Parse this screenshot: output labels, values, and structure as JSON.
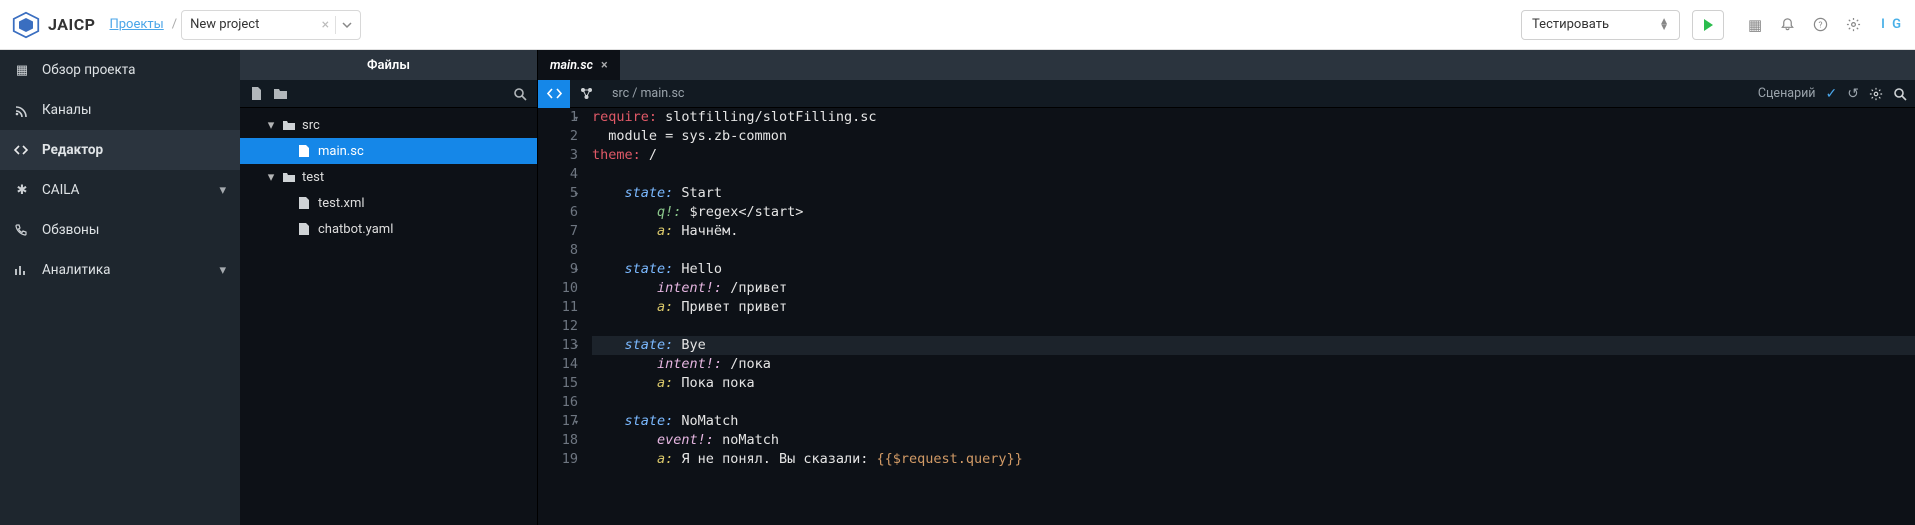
{
  "header": {
    "brand": "JAICP",
    "projects_link": "Проекты",
    "project_name": "New project",
    "test_label": "Тестировать",
    "user_initials": "I G"
  },
  "sidebar": {
    "items": [
      {
        "icon": "grid-icon",
        "label": "Обзор проекта",
        "expandable": false
      },
      {
        "icon": "rss-icon",
        "label": "Каналы",
        "expandable": false
      },
      {
        "icon": "code-icon",
        "label": "Редактор",
        "active": true
      },
      {
        "icon": "atom-icon",
        "label": "CAILA",
        "expandable": true
      },
      {
        "icon": "phone-icon",
        "label": "Обзвоны",
        "expandable": false
      },
      {
        "icon": "chart-icon",
        "label": "Аналитика",
        "expandable": true
      }
    ]
  },
  "filepanel": {
    "title": "Файлы",
    "tree": {
      "src_label": "src",
      "main_file": "main.sc",
      "test_label": "test",
      "test_file": "test.xml",
      "chatbot_file": "chatbot.yaml"
    }
  },
  "editor": {
    "tab_name": "main.sc",
    "breadcrumb": "src / main.sc",
    "scenario_label": "Сценарий",
    "lines": [
      {
        "num": 1,
        "fold": true,
        "tokens": [
          {
            "c": "tok-r",
            "t": "require:"
          },
          {
            "c": "tok-w",
            "t": " slotfilling/slotFilling.sc"
          }
        ]
      },
      {
        "num": 2,
        "tokens": [
          {
            "c": "tok-w",
            "t": "  module = sys.zb-common"
          }
        ]
      },
      {
        "num": 3,
        "tokens": [
          {
            "c": "tok-r",
            "t": "theme:"
          },
          {
            "c": "tok-w",
            "t": " /"
          }
        ]
      },
      {
        "num": 4,
        "tokens": []
      },
      {
        "num": 5,
        "fold": true,
        "tokens": [
          {
            "c": "tok-w",
            "t": "    "
          },
          {
            "c": "tok-b",
            "t": "state:"
          },
          {
            "c": "tok-w",
            "t": " Start"
          }
        ]
      },
      {
        "num": 6,
        "tokens": [
          {
            "c": "tok-w",
            "t": "        "
          },
          {
            "c": "tok-g",
            "t": "q!:"
          },
          {
            "c": "tok-w",
            "t": " $regex</start>"
          }
        ]
      },
      {
        "num": 7,
        "tokens": [
          {
            "c": "tok-w",
            "t": "        "
          },
          {
            "c": "tok-y",
            "t": "a:"
          },
          {
            "c": "tok-w",
            "t": " Начнём."
          }
        ]
      },
      {
        "num": 8,
        "tokens": []
      },
      {
        "num": 9,
        "fold": true,
        "tokens": [
          {
            "c": "tok-w",
            "t": "    "
          },
          {
            "c": "tok-b",
            "t": "state:"
          },
          {
            "c": "tok-w",
            "t": " Hello"
          }
        ]
      },
      {
        "num": 10,
        "tokens": [
          {
            "c": "tok-w",
            "t": "        "
          },
          {
            "c": "tok-m",
            "t": "intent!:"
          },
          {
            "c": "tok-w",
            "t": " /привет"
          }
        ]
      },
      {
        "num": 11,
        "tokens": [
          {
            "c": "tok-w",
            "t": "        "
          },
          {
            "c": "tok-y",
            "t": "a:"
          },
          {
            "c": "tok-w",
            "t": " Привет привет"
          }
        ]
      },
      {
        "num": 12,
        "tokens": []
      },
      {
        "num": 13,
        "fold": true,
        "hilite": true,
        "tokens": [
          {
            "c": "tok-w",
            "t": "    "
          },
          {
            "c": "tok-b",
            "t": "state:"
          },
          {
            "c": "tok-w",
            "t": " Bye"
          }
        ]
      },
      {
        "num": 14,
        "tokens": [
          {
            "c": "tok-w",
            "t": "        "
          },
          {
            "c": "tok-m",
            "t": "intent!:"
          },
          {
            "c": "tok-w",
            "t": " /пока"
          }
        ]
      },
      {
        "num": 15,
        "tokens": [
          {
            "c": "tok-w",
            "t": "        "
          },
          {
            "c": "tok-y",
            "t": "a:"
          },
          {
            "c": "tok-w",
            "t": " Пока пока"
          }
        ]
      },
      {
        "num": 16,
        "tokens": []
      },
      {
        "num": 17,
        "fold": true,
        "tokens": [
          {
            "c": "tok-w",
            "t": "    "
          },
          {
            "c": "tok-b",
            "t": "state:"
          },
          {
            "c": "tok-w",
            "t": " NoMatch"
          }
        ]
      },
      {
        "num": 18,
        "tokens": [
          {
            "c": "tok-w",
            "t": "        "
          },
          {
            "c": "tok-m",
            "t": "event!:"
          },
          {
            "c": "tok-w",
            "t": " noMatch"
          }
        ]
      },
      {
        "num": 19,
        "tokens": [
          {
            "c": "tok-w",
            "t": "        "
          },
          {
            "c": "tok-y",
            "t": "a:"
          },
          {
            "c": "tok-w",
            "t": " Я не понял. Вы сказали: "
          },
          {
            "c": "tok-num",
            "t": "{{$request.query}}"
          }
        ]
      }
    ]
  }
}
